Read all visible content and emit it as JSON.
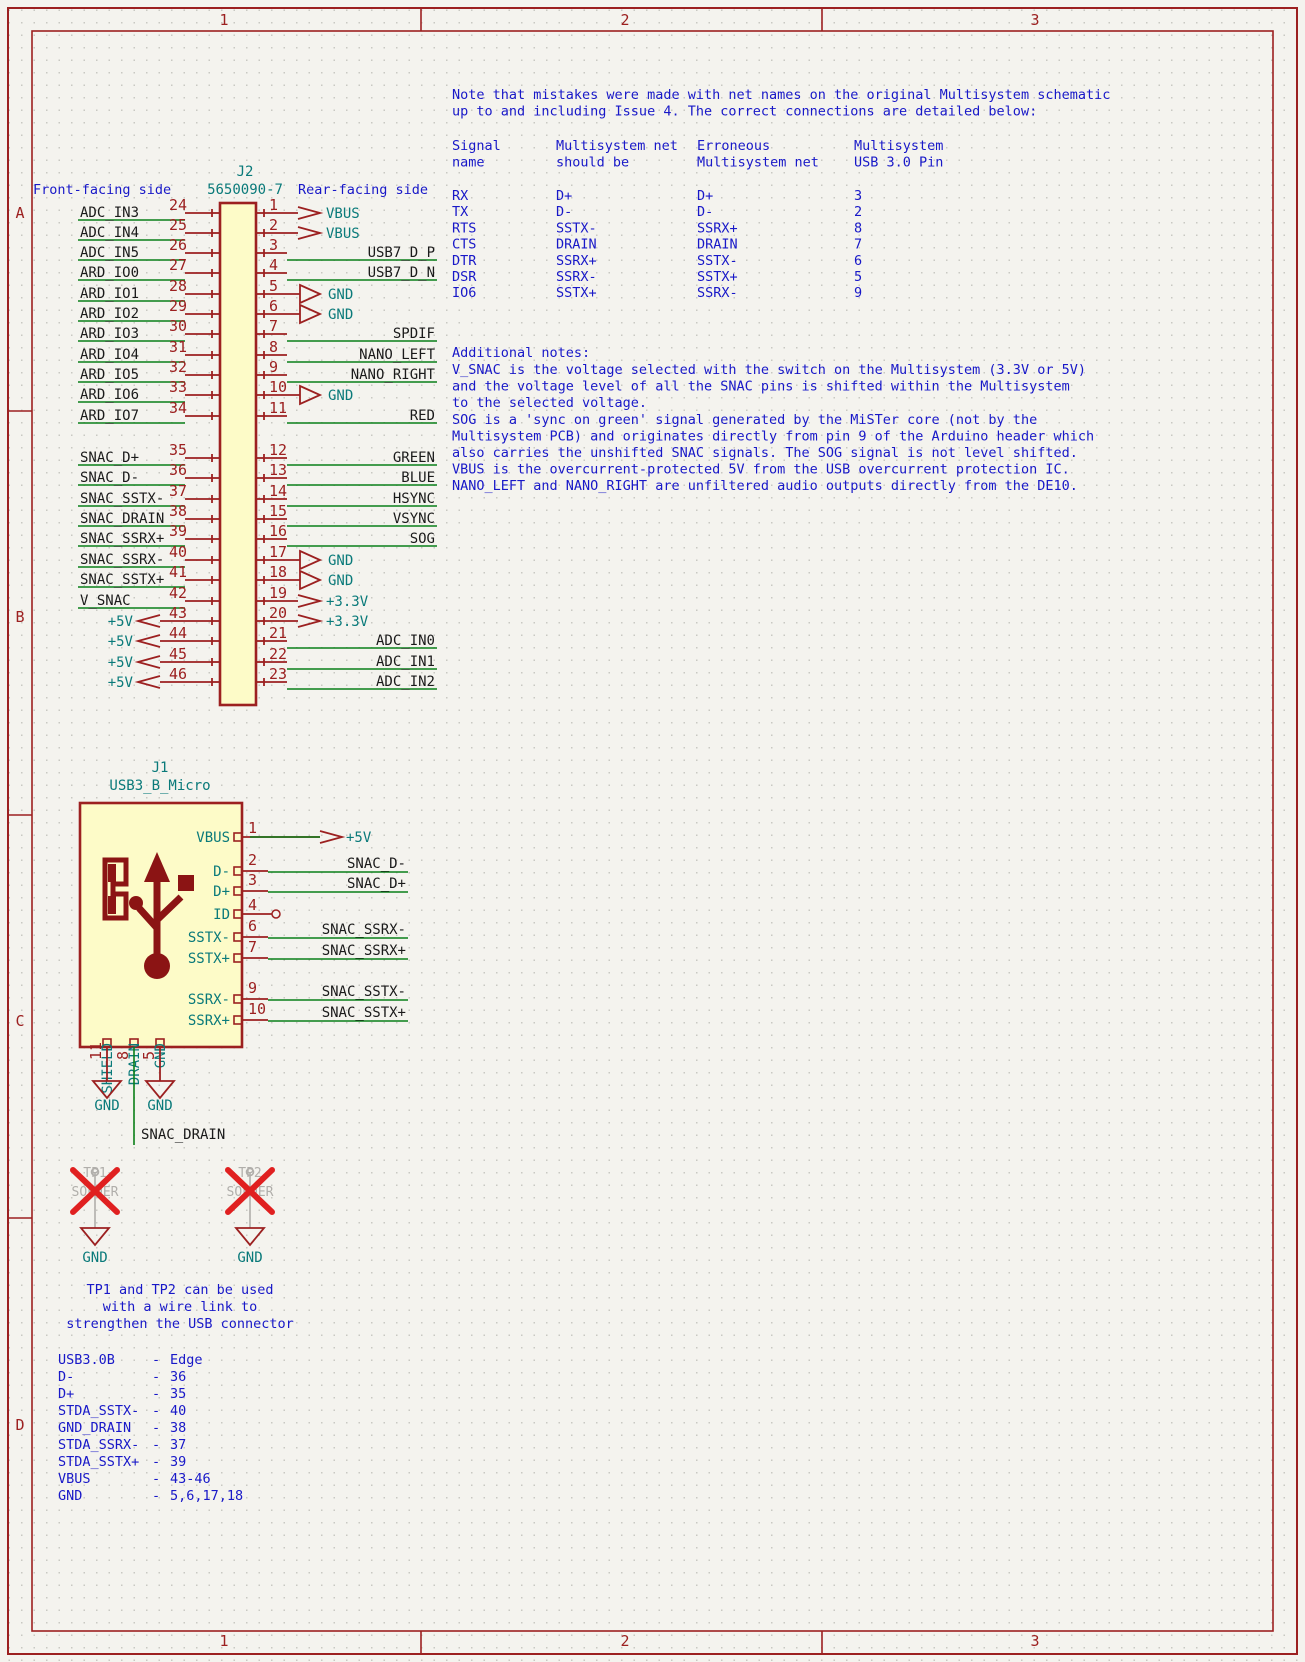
{
  "sheet": {
    "zones_top": [
      "1",
      "2",
      "3"
    ],
    "zones_bottom": [
      "1",
      "2",
      "3"
    ],
    "zones_left": [
      "A",
      "B",
      "C",
      "D"
    ],
    "bg_color": "#f4f3ee",
    "border_color": "#9c2020"
  },
  "j2": {
    "ref": "J2",
    "value": "5650090-7",
    "left_header": "Front-facing side",
    "right_header": "Rear-facing side",
    "left_pins": [
      {
        "pin": "24",
        "label": "ADC_IN3",
        "kind": "wire"
      },
      {
        "pin": "25",
        "label": "ADC_IN4",
        "kind": "wire"
      },
      {
        "pin": "26",
        "label": "ADC_IN5",
        "kind": "wire"
      },
      {
        "pin": "27",
        "label": "ARD_IO0",
        "kind": "wire"
      },
      {
        "pin": "28",
        "label": "ARD_IO1",
        "kind": "wire"
      },
      {
        "pin": "29",
        "label": "ARD_IO2",
        "kind": "wire"
      },
      {
        "pin": "30",
        "label": "ARD_IO3",
        "kind": "wire"
      },
      {
        "pin": "31",
        "label": "ARD_IO4",
        "kind": "wire"
      },
      {
        "pin": "32",
        "label": "ARD_IO5",
        "kind": "wire"
      },
      {
        "pin": "33",
        "label": "ARD_IO6",
        "kind": "wire"
      },
      {
        "pin": "34",
        "label": "ARD_IO7",
        "kind": "wire"
      },
      {
        "pin": "35",
        "label": "SNAC_D+",
        "kind": "wire"
      },
      {
        "pin": "36",
        "label": "SNAC_D-",
        "kind": "wire"
      },
      {
        "pin": "37",
        "label": "SNAC_SSTX-",
        "kind": "wire"
      },
      {
        "pin": "38",
        "label": "SNAC_DRAIN",
        "kind": "wire"
      },
      {
        "pin": "39",
        "label": "SNAC_SSRX+",
        "kind": "wire"
      },
      {
        "pin": "40",
        "label": "SNAC_SSRX-",
        "kind": "wire"
      },
      {
        "pin": "41",
        "label": "SNAC_SSTX+",
        "kind": "wire"
      },
      {
        "pin": "42",
        "label": "V_SNAC",
        "kind": "wire"
      },
      {
        "pin": "43",
        "label": "+5V",
        "kind": "power"
      },
      {
        "pin": "44",
        "label": "+5V",
        "kind": "power"
      },
      {
        "pin": "45",
        "label": "+5V",
        "kind": "power"
      },
      {
        "pin": "46",
        "label": "+5V",
        "kind": "power"
      }
    ],
    "right_pins": [
      {
        "pin": "1",
        "label": "VBUS",
        "kind": "power"
      },
      {
        "pin": "2",
        "label": "VBUS",
        "kind": "power"
      },
      {
        "pin": "3",
        "label": "USB7_D_P",
        "kind": "wire"
      },
      {
        "pin": "4",
        "label": "USB7_D_N",
        "kind": "wire"
      },
      {
        "pin": "5",
        "label": "GND",
        "kind": "gnd"
      },
      {
        "pin": "6",
        "label": "GND",
        "kind": "gnd"
      },
      {
        "pin": "7",
        "label": "SPDIF",
        "kind": "wire"
      },
      {
        "pin": "8",
        "label": "NANO_LEFT",
        "kind": "wire"
      },
      {
        "pin": "9",
        "label": "NANO_RIGHT",
        "kind": "wire"
      },
      {
        "pin": "10",
        "label": "GND",
        "kind": "gnd"
      },
      {
        "pin": "11",
        "label": "RED",
        "kind": "wire"
      },
      {
        "pin": "12",
        "label": "GREEN",
        "kind": "wire"
      },
      {
        "pin": "13",
        "label": "BLUE",
        "kind": "wire"
      },
      {
        "pin": "14",
        "label": "HSYNC",
        "kind": "wire"
      },
      {
        "pin": "15",
        "label": "VSYNC",
        "kind": "wire"
      },
      {
        "pin": "16",
        "label": "SOG",
        "kind": "wire"
      },
      {
        "pin": "17",
        "label": "GND",
        "kind": "gnd"
      },
      {
        "pin": "18",
        "label": "GND",
        "kind": "gnd"
      },
      {
        "pin": "19",
        "label": "+3.3V",
        "kind": "power"
      },
      {
        "pin": "20",
        "label": "+3.3V",
        "kind": "power"
      },
      {
        "pin": "21",
        "label": "ADC_IN0",
        "kind": "wire"
      },
      {
        "pin": "22",
        "label": "ADC_IN1",
        "kind": "wire"
      },
      {
        "pin": "23",
        "label": "ADC_IN2",
        "kind": "wire"
      }
    ]
  },
  "j1": {
    "ref": "J1",
    "value": "USB3_B_Micro",
    "right_pins": [
      {
        "pin": "1",
        "name": "VBUS",
        "net": "+5V",
        "kind": "power"
      },
      {
        "pin": "2",
        "name": "D-",
        "net": "SNAC_D-",
        "kind": "wire"
      },
      {
        "pin": "3",
        "name": "D+",
        "net": "SNAC_D+",
        "kind": "wire"
      },
      {
        "pin": "4",
        "name": "ID",
        "net": "",
        "kind": "nc"
      },
      {
        "pin": "6",
        "name": "SSTX-",
        "net": "SNAC_SSRX-",
        "kind": "wire"
      },
      {
        "pin": "7",
        "name": "SSTX+",
        "net": "SNAC_SSRX+",
        "kind": "wire"
      },
      {
        "pin": "9",
        "name": "SSRX-",
        "net": "SNAC_SSTX-",
        "kind": "wire"
      },
      {
        "pin": "10",
        "name": "SSRX+",
        "net": "SNAC_SSTX+",
        "kind": "wire"
      }
    ],
    "bottom_pins": [
      {
        "pin": "11",
        "name": "SHIELD",
        "net": "GND"
      },
      {
        "pin": "8",
        "name": "DRAIN",
        "net": "SNAC_DRAIN"
      },
      {
        "pin": "5",
        "name": "GND",
        "net": "GND"
      }
    ]
  },
  "testpoints": [
    {
      "ref": "TP1",
      "value": "SOLDER",
      "net": "GND",
      "dnp": true
    },
    {
      "ref": "TP2",
      "value": "SOLDER",
      "net": "GND",
      "dnp": true
    }
  ],
  "note_top": {
    "intro": [
      "Note that mistakes were made with net names on the original Multisystem schematic",
      "up to and including Issue 4. The correct connections are detailed below:"
    ],
    "columns": [
      [
        "Signal",
        "name"
      ],
      [
        "Multisystem net",
        "should be"
      ],
      [
        "Erroneous",
        "Multisystem net"
      ],
      [
        "Multisystem",
        "USB 3.0 Pin"
      ]
    ],
    "rows": [
      [
        "RX",
        "D+",
        "D+",
        "3"
      ],
      [
        "TX",
        "D-",
        "D-",
        "2"
      ],
      [
        "RTS",
        "SSTX-",
        "SSRX+",
        "8"
      ],
      [
        "CTS",
        "DRAIN",
        "DRAIN",
        "7"
      ],
      [
        "DTR",
        "SSRX+",
        "SSTX-",
        "6"
      ],
      [
        "DSR",
        "SSRX-",
        "SSTX+",
        "5"
      ],
      [
        "IO6",
        "SSTX+",
        "SSRX-",
        "9"
      ]
    ]
  },
  "note_additional": {
    "title": "Additional notes:",
    "lines": [
      "V_SNAC is the voltage selected with the switch on the Multisystem (3.3V or 5V)",
      "and the voltage level of all the SNAC pins is shifted within the Multisystem",
      "to the selected voltage.",
      "SOG is a 'sync on green' signal generated by the MiSTer core (not by the",
      "Multisystem PCB) and originates directly from pin 9 of the Arduino header which",
      "also carries the unshifted SNAC signals. The SOG signal is not level shifted.",
      "VBUS is the overcurrent-protected 5V from the USB overcurrent protection IC.",
      "NANO_LEFT and NANO_RIGHT are unfiltered audio outputs directly from the DE10."
    ]
  },
  "note_tp": {
    "lines": [
      "TP1 and TP2 can be used",
      "with a wire link to",
      "strengthen the USB connector"
    ]
  },
  "note_pinmap": {
    "rows": [
      {
        "name": "USB3.0B",
        "dash": "-",
        "pin": "Edge"
      },
      {
        "name": "D-",
        "dash": "-",
        "pin": "36"
      },
      {
        "name": "D+",
        "dash": "-",
        "pin": "35"
      },
      {
        "name": "STDA_SSTX-",
        "dash": "-",
        "pin": "40"
      },
      {
        "name": "GND_DRAIN",
        "dash": "-",
        "pin": "38"
      },
      {
        "name": "STDA_SSRX-",
        "dash": "-",
        "pin": "37"
      },
      {
        "name": "STDA_SSTX+",
        "dash": "-",
        "pin": "39"
      },
      {
        "name": "VBUS",
        "dash": "-",
        "pin": "43-46"
      },
      {
        "name": "GND",
        "dash": "-",
        "pin": "5,6,17,18"
      }
    ]
  }
}
